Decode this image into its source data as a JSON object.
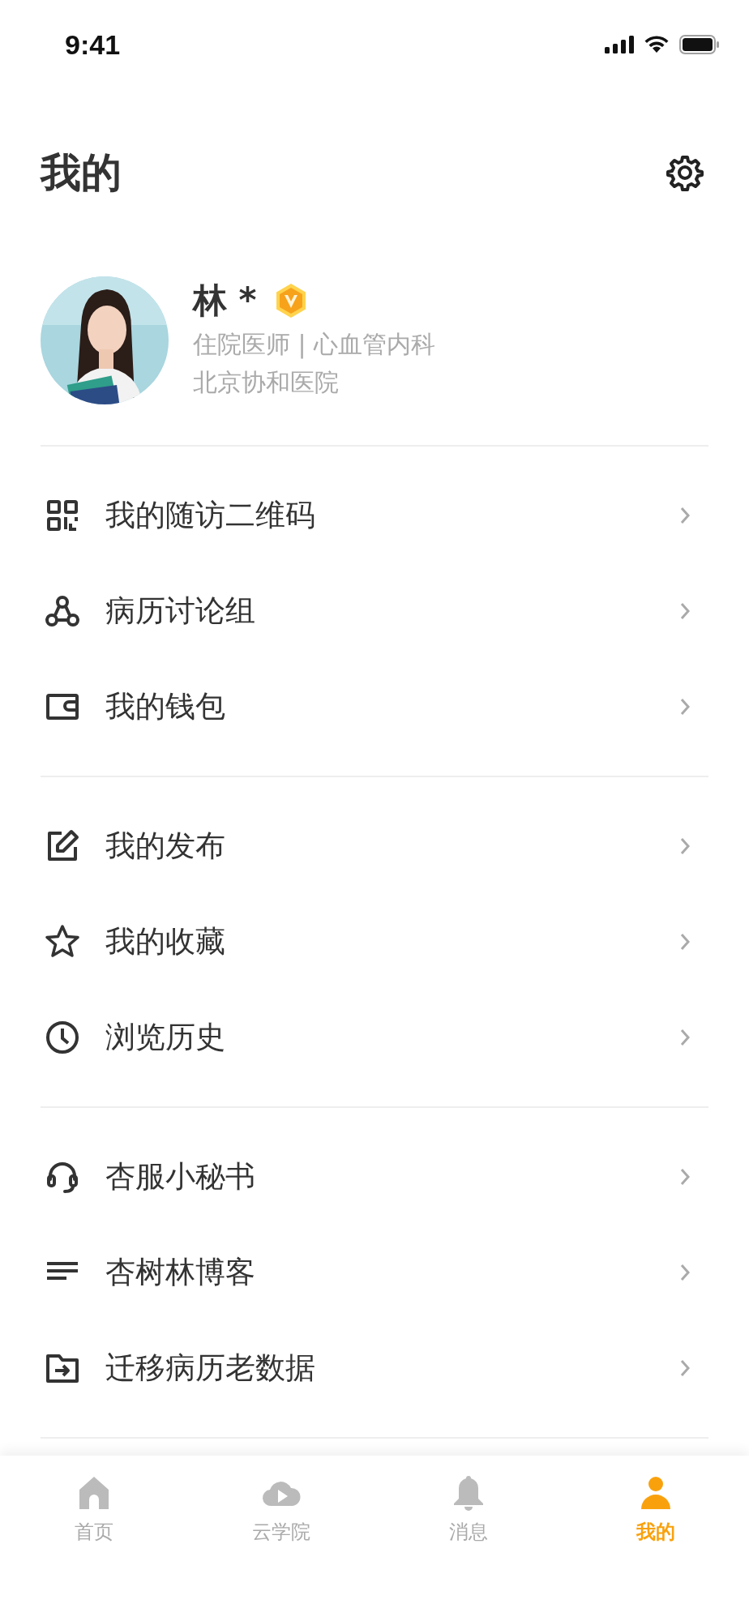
{
  "status_bar": {
    "time": "9:41"
  },
  "header": {
    "title": "我的"
  },
  "profile": {
    "name": "林 *",
    "verified": true,
    "position": "住院医师 | 心血管内科",
    "hospital": "北京协和医院"
  },
  "menu_groups": [
    {
      "items": [
        {
          "label": "我的随访二维码"
        },
        {
          "label": "病历讨论组"
        },
        {
          "label": "我的钱包"
        }
      ]
    },
    {
      "items": [
        {
          "label": "我的发布"
        },
        {
          "label": "我的收藏"
        },
        {
          "label": "浏览历史"
        }
      ]
    },
    {
      "items": [
        {
          "label": "杏服小秘书"
        },
        {
          "label": "杏树林博客"
        },
        {
          "label": "迁移病历老数据"
        }
      ]
    }
  ],
  "tab_bar": [
    {
      "label": "首页",
      "selected": false
    },
    {
      "label": "云学院",
      "selected": false
    },
    {
      "label": "消息",
      "selected": false
    },
    {
      "label": "我的",
      "selected": true
    }
  ]
}
